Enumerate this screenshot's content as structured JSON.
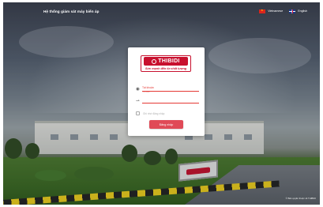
{
  "header": {
    "title": "Hệ thống giám sát máy biến áp",
    "languages": [
      {
        "label": "Vietnamese",
        "flag": "vn-flag-icon"
      },
      {
        "label": "English",
        "flag": "uk-flag-icon"
      }
    ]
  },
  "login": {
    "logo_text": "THIBIDI",
    "slogan": "Sức mạnh đến từ chất lượng",
    "username_placeholder": "Tài khoản",
    "username_hint": "Tài khoản",
    "password_placeholder": "",
    "remember_label": "Ghi nhớ đăng nhập",
    "submit_label": "Đăng nhập",
    "accent_color": "#c8102e",
    "button_color": "#e04a57"
  },
  "footer": {
    "copyright": "© Bản quyền thuộc về THIBIDI"
  }
}
